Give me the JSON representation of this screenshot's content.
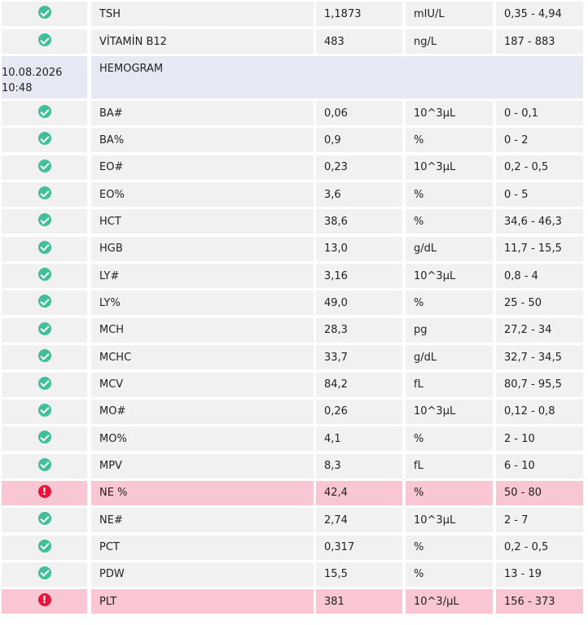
{
  "colors": {
    "normal_row_bg": "#f1f1f1",
    "abnormal_row_bg": "#f9c6d3",
    "group_header_bg": "#e6e9f4",
    "ok_icon": "#3fbf9a",
    "alert_icon": "#e5173f"
  },
  "icons": {
    "ok": "check-circle-icon",
    "alert": "exclamation-circle-icon",
    "alert_glyph": "!"
  },
  "group": {
    "date": "10.08.2026",
    "time": "10:48",
    "name": "HEMOGRAM"
  },
  "rows": [
    {
      "status": "ok",
      "name": "TSH",
      "value": "1,1873",
      "unit": "mIU/L",
      "ref": "0,35 - 4,94"
    },
    {
      "status": "ok",
      "name": "VİTAMİN B12",
      "value": "483",
      "unit": "ng/L",
      "ref": "187 - 883"
    },
    {
      "status": "ok",
      "name": "BA#",
      "value": "0,06",
      "unit": "10^3µL",
      "ref": "0 - 0,1"
    },
    {
      "status": "ok",
      "name": "BA%",
      "value": "0,9",
      "unit": "%",
      "ref": "0 - 2"
    },
    {
      "status": "ok",
      "name": "EO#",
      "value": "0,23",
      "unit": "10^3µL",
      "ref": "0,2 - 0,5"
    },
    {
      "status": "ok",
      "name": "EO%",
      "value": "3,6",
      "unit": "%",
      "ref": "0 - 5"
    },
    {
      "status": "ok",
      "name": "HCT",
      "value": "38,6",
      "unit": "%",
      "ref": "34,6 - 46,3"
    },
    {
      "status": "ok",
      "name": "HGB",
      "value": "13,0",
      "unit": "g/dL",
      "ref": "11,7 - 15,5"
    },
    {
      "status": "ok",
      "name": "LY#",
      "value": "3,16",
      "unit": "10^3µL",
      "ref": "0,8 - 4"
    },
    {
      "status": "ok",
      "name": "LY%",
      "value": "49,0",
      "unit": "%",
      "ref": "25 - 50"
    },
    {
      "status": "ok",
      "name": "MCH",
      "value": "28,3",
      "unit": "pg",
      "ref": "27,2 - 34"
    },
    {
      "status": "ok",
      "name": "MCHC",
      "value": "33,7",
      "unit": "g/dL",
      "ref": "32,7 - 34,5"
    },
    {
      "status": "ok",
      "name": "MCV",
      "value": "84,2",
      "unit": "fL",
      "ref": "80,7 - 95,5"
    },
    {
      "status": "ok",
      "name": "MO#",
      "value": "0,26",
      "unit": "10^3µL",
      "ref": "0,12 - 0,8"
    },
    {
      "status": "ok",
      "name": "MO%",
      "value": "4,1",
      "unit": "%",
      "ref": "2 - 10"
    },
    {
      "status": "ok",
      "name": "MPV",
      "value": "8,3",
      "unit": "fL",
      "ref": "6 - 10"
    },
    {
      "status": "alert",
      "name": "NE %",
      "value": "42,4",
      "unit": "%",
      "ref": "50 - 80"
    },
    {
      "status": "ok",
      "name": "NE#",
      "value": "2,74",
      "unit": "10^3µL",
      "ref": "2 - 7"
    },
    {
      "status": "ok",
      "name": "PCT",
      "value": "0,317",
      "unit": "%",
      "ref": "0,2 - 0,5"
    },
    {
      "status": "ok",
      "name": "PDW",
      "value": "15,5",
      "unit": "%",
      "ref": "13 - 19"
    },
    {
      "status": "alert",
      "name": "PLT",
      "value": "381",
      "unit": "10^3/µL",
      "ref": "156 - 373"
    }
  ]
}
